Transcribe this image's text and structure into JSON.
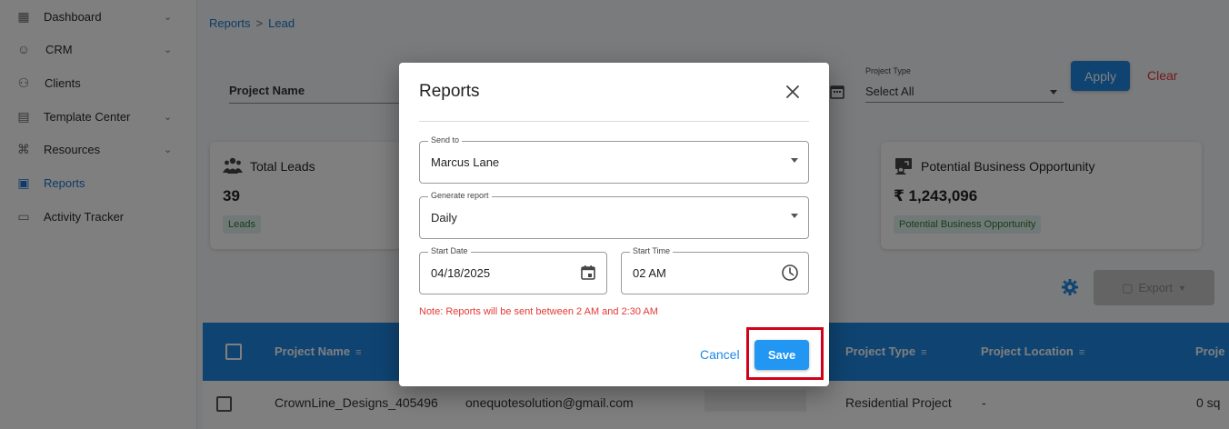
{
  "sidebar": {
    "items": [
      {
        "label": "Dashboard",
        "icon": "grid-icon",
        "has_chevron": true
      },
      {
        "label": "CRM",
        "icon": "crm-icon",
        "has_chevron": true
      },
      {
        "label": "Clients",
        "icon": "people-icon",
        "has_chevron": false
      },
      {
        "label": "Template Center",
        "icon": "template-icon",
        "has_chevron": true
      },
      {
        "label": "Resources",
        "icon": "resources-icon",
        "has_chevron": true
      },
      {
        "label": "Reports",
        "icon": "reports-icon",
        "has_chevron": false,
        "active": true
      },
      {
        "label": "Activity Tracker",
        "icon": "tracker-icon",
        "has_chevron": false
      }
    ]
  },
  "breadcrumb": {
    "root": "Reports",
    "separator": ">",
    "current": "Lead"
  },
  "filters": {
    "project_name_label": "Project Name",
    "project_type_label": "Project Type",
    "project_type_value": "Select All",
    "apply_label": "Apply",
    "clear_label": "Clear"
  },
  "cards": {
    "total_leads": {
      "title": "Total Leads",
      "value": "39",
      "tag": "Leads"
    },
    "potential": {
      "title": "Potential Business Opportunity",
      "value": "₹ 1,243,096",
      "tag": "Potential Business Opportunity"
    }
  },
  "toolbar": {
    "export_label": "Export"
  },
  "table": {
    "headers": {
      "project_name": "Project Name",
      "project_type": "Project Type",
      "project_location": "Project Location",
      "proj_truncated": "Proje"
    },
    "row": {
      "project_name": "CrownLine_Designs_405496",
      "email": "onequotesolution@gmail.com",
      "project_type": "Residential Project",
      "project_location": "-",
      "size_truncated": "0 sq"
    }
  },
  "modal": {
    "title": "Reports",
    "send_to": {
      "label": "Send to",
      "value": "Marcus Lane"
    },
    "generate_report": {
      "label": "Generate report",
      "value": "Daily"
    },
    "start_date": {
      "label": "Start Date",
      "value": "04/18/2025"
    },
    "start_time": {
      "label": "Start Time",
      "value": "02 AM"
    },
    "note": "Note: Reports will be sent between 2 AM and 2:30 AM",
    "cancel_label": "Cancel",
    "save_label": "Save"
  },
  "colors": {
    "accent": "#1e88e5",
    "danger": "#e53935",
    "highlight": "#d0021b"
  }
}
